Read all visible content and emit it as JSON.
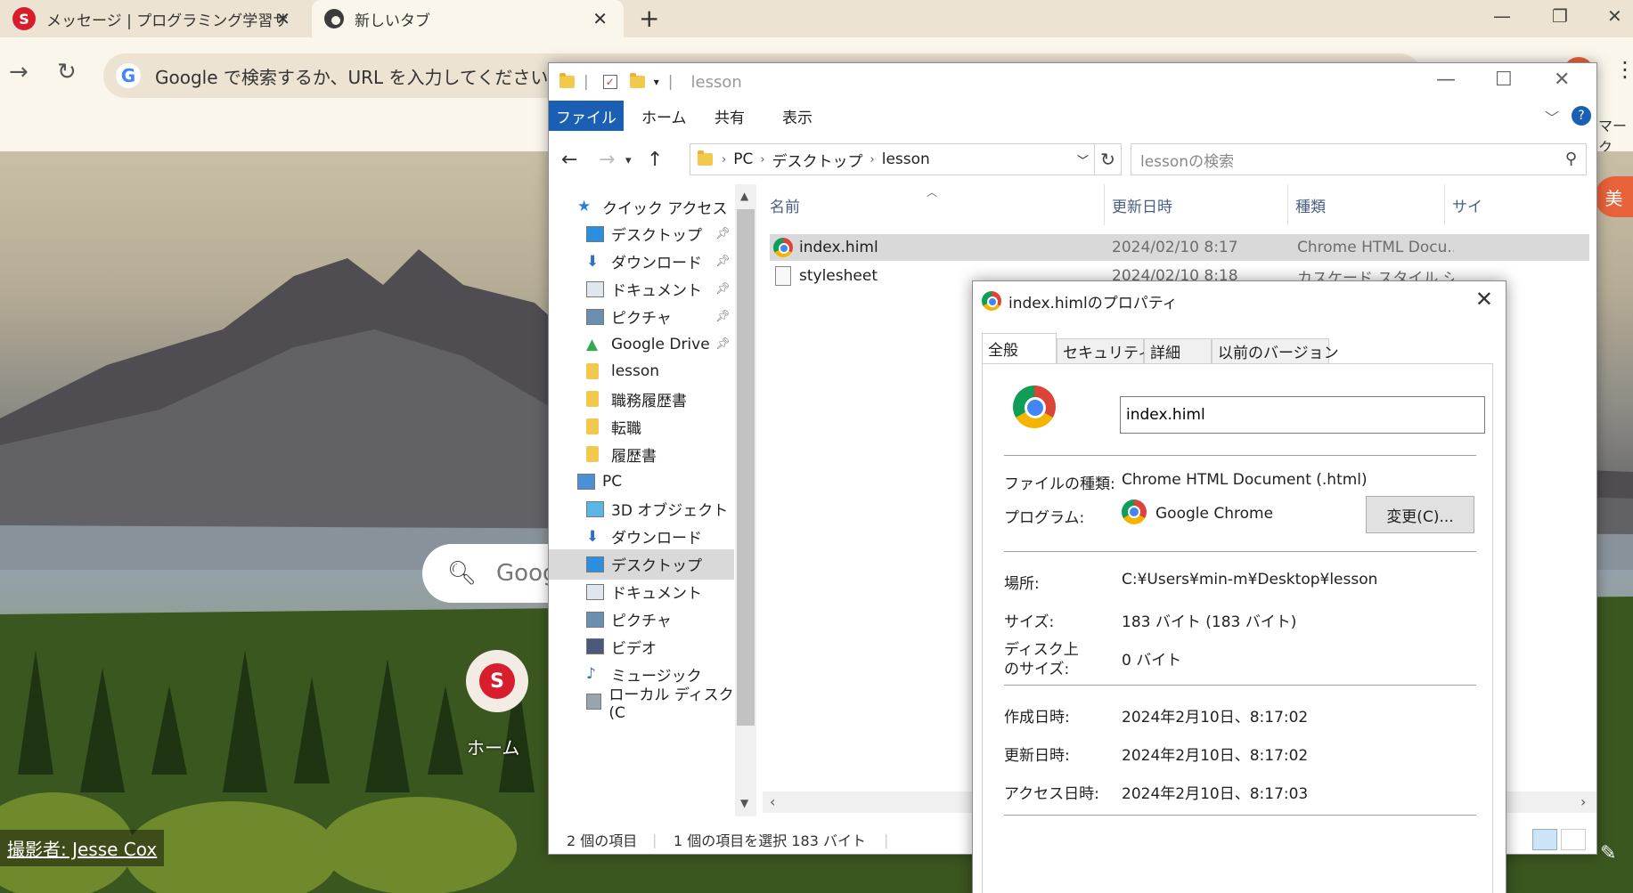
{
  "browser": {
    "tabs": [
      {
        "title": "メッセージ | プログラミング学習サイト",
        "icon": "samurai-icon",
        "active": false
      },
      {
        "title": "新しいタブ",
        "icon": "chrome-icon",
        "active": true
      }
    ],
    "omnibox_placeholder": "Google で検索するか、URL を入力してください",
    "bookmark_label": "マーク",
    "ntp": {
      "search_placeholder": "Google",
      "shortcut_label": "ホーム",
      "shortcut_icon_glyph": "S",
      "photo_credit": "撮影者: Jesse Cox",
      "profile_glyph": "美"
    }
  },
  "explorer": {
    "title": "lesson",
    "ribbon_tabs": [
      "ファイル",
      "ホーム",
      "共有",
      "表示"
    ],
    "breadcrumb": [
      "PC",
      "デスクトップ",
      "lesson"
    ],
    "search_placeholder": "lessonの検索",
    "nav_items": [
      {
        "label": "クイック アクセス",
        "icon": "star-icon",
        "pinned": false,
        "selected": false
      },
      {
        "label": "デスクトップ",
        "icon": "desktop-icon",
        "pinned": true,
        "selected": false
      },
      {
        "label": "ダウンロード",
        "icon": "download-icon",
        "pinned": true,
        "selected": false
      },
      {
        "label": "ドキュメント",
        "icon": "document-icon",
        "pinned": true,
        "selected": false
      },
      {
        "label": "ピクチャ",
        "icon": "picture-icon",
        "pinned": true,
        "selected": false
      },
      {
        "label": "Google Drive",
        "icon": "google-drive-icon",
        "pinned": true,
        "selected": false
      },
      {
        "label": "lesson",
        "icon": "folder-icon",
        "pinned": false,
        "selected": false
      },
      {
        "label": "職務履歴書",
        "icon": "folder-icon",
        "pinned": false,
        "selected": false
      },
      {
        "label": "転職",
        "icon": "folder-icon",
        "pinned": false,
        "selected": false
      },
      {
        "label": "履歴書",
        "icon": "folder-icon",
        "pinned": false,
        "selected": false
      },
      {
        "label": "PC",
        "icon": "pc-icon",
        "pinned": false,
        "selected": false
      },
      {
        "label": "3D オブジェクト",
        "icon": "3d-objects-icon",
        "pinned": false,
        "selected": false
      },
      {
        "label": "ダウンロード",
        "icon": "download-icon",
        "pinned": false,
        "selected": false
      },
      {
        "label": "デスクトップ",
        "icon": "desktop-icon",
        "pinned": false,
        "selected": true
      },
      {
        "label": "ドキュメント",
        "icon": "document-icon",
        "pinned": false,
        "selected": false
      },
      {
        "label": "ピクチャ",
        "icon": "picture-icon",
        "pinned": false,
        "selected": false
      },
      {
        "label": "ビデオ",
        "icon": "video-icon",
        "pinned": false,
        "selected": false
      },
      {
        "label": "ミュージック",
        "icon": "music-icon",
        "pinned": false,
        "selected": false
      },
      {
        "label": "ローカル ディスク (C",
        "icon": "drive-icon",
        "pinned": false,
        "selected": false
      }
    ],
    "columns": [
      "名前",
      "更新日時",
      "種類",
      "サイ"
    ],
    "files": [
      {
        "name": "index.himl",
        "modified": "2024/02/10 8:17",
        "type": "Chrome HTML Docu...",
        "icon": "chrome-icon",
        "selected": true
      },
      {
        "name": "stylesheet",
        "modified": "2024/02/10 8:18",
        "type": "カスケード スタイル シート...",
        "icon": "css-file-icon",
        "selected": false
      }
    ],
    "status": {
      "count": "2 個の項目",
      "selection": "1 個の項目を選択  183 バイト"
    }
  },
  "properties": {
    "title": "index.himlのプロパティ",
    "tabs": [
      "全般",
      "セキュリティ",
      "詳細",
      "以前のバージョン"
    ],
    "filename": "index.himl",
    "rows": {
      "file_type_label": "ファイルの種類:",
      "file_type_value": "Chrome HTML Document (.html)",
      "program_label": "プログラム:",
      "program_value": "Google Chrome",
      "change_button": "変更(C)...",
      "location_label": "場所:",
      "location_value": "C:¥Users¥min-m¥Desktop¥lesson",
      "size_label": "サイズ:",
      "size_value": "183 バイト (183 バイト)",
      "disk_size_label_1": "ディスク上",
      "disk_size_label_2": "のサイズ:",
      "disk_size_value": "0 バイト",
      "created_label": "作成日時:",
      "created_value": "2024年2月10日、8:17:02",
      "modified_label": "更新日時:",
      "modified_value": "2024年2月10日、8:17:02",
      "accessed_label": "アクセス日時:",
      "accessed_value": "2024年2月10日、8:17:03"
    }
  }
}
